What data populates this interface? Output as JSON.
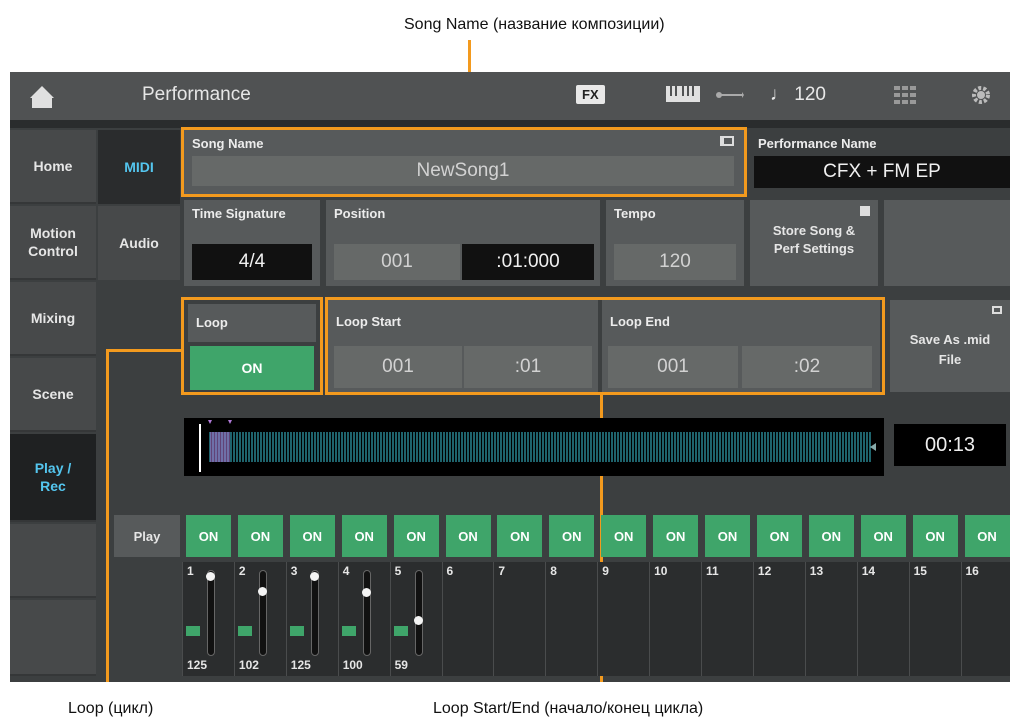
{
  "callouts": {
    "song_name": "Song Name (название композиции)",
    "loop": "Loop (цикл)",
    "loop_start_end": "Loop Start/End (начало/конец цикла)"
  },
  "topbar": {
    "title": "Performance",
    "fx": "FX",
    "tempo": "♩ 120"
  },
  "sidebar": {
    "items": [
      {
        "label": "Home"
      },
      {
        "label": "Motion Control"
      },
      {
        "label": "Mixing"
      },
      {
        "label": "Scene"
      },
      {
        "label": "Play / Rec"
      }
    ]
  },
  "subtabs": [
    {
      "label": "MIDI"
    },
    {
      "label": "Audio"
    }
  ],
  "song_name": {
    "label": "Song Name",
    "value": "NewSong1"
  },
  "performance_name": {
    "label": "Performance Name",
    "value": "CFX + FM EP"
  },
  "time_signature": {
    "label": "Time Signature",
    "value": "4/4"
  },
  "position": {
    "label": "Position",
    "measure": "001",
    "beat": ":01:000"
  },
  "tempo": {
    "label": "Tempo",
    "value": "120"
  },
  "store": {
    "label": "Store Song & Perf Settings"
  },
  "loop": {
    "label": "Loop",
    "value": "ON"
  },
  "loop_start": {
    "label": "Loop Start",
    "measure": "001",
    "beat": ":01"
  },
  "loop_end": {
    "label": "Loop End",
    "measure": "001",
    "beat": ":02"
  },
  "save_mid": {
    "label": "Save As .mid File"
  },
  "time_display": "00:13",
  "play_label": "Play",
  "tracks": [
    {
      "num": "1",
      "on": "ON",
      "volume": "125",
      "level": 0.98
    },
    {
      "num": "2",
      "on": "ON",
      "volume": "102",
      "level": 0.8
    },
    {
      "num": "3",
      "on": "ON",
      "volume": "125",
      "level": 0.98
    },
    {
      "num": "4",
      "on": "ON",
      "volume": "100",
      "level": 0.79
    },
    {
      "num": "5",
      "on": "ON",
      "volume": "59",
      "level": 0.46
    },
    {
      "num": "6",
      "on": "ON"
    },
    {
      "num": "7",
      "on": "ON"
    },
    {
      "num": "8",
      "on": "ON"
    },
    {
      "num": "9",
      "on": "ON"
    },
    {
      "num": "10",
      "on": "ON"
    },
    {
      "num": "11",
      "on": "ON"
    },
    {
      "num": "12",
      "on": "ON"
    },
    {
      "num": "13",
      "on": "ON"
    },
    {
      "num": "14",
      "on": "ON"
    },
    {
      "num": "15",
      "on": "ON"
    },
    {
      "num": "16",
      "on": "ON"
    }
  ],
  "colors": {
    "accent": "#54c6ef",
    "on_green": "#3fa56a",
    "callout_orange": "#f39a1e"
  }
}
